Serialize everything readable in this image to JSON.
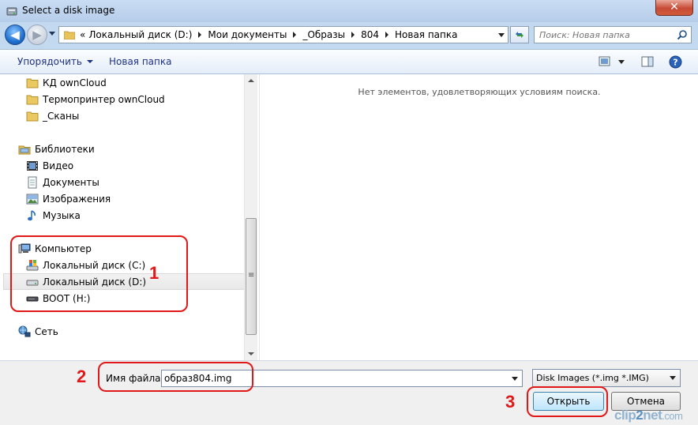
{
  "window": {
    "title": "Select a disk image",
    "close_label": "✕"
  },
  "address_bar": {
    "overflow": "«",
    "crumbs": [
      "Локальный диск (D:)",
      "Мои документы",
      "_Образы",
      "804",
      "Новая папка"
    ]
  },
  "search": {
    "placeholder": "Поиск: Новая папка"
  },
  "toolbar": {
    "organize_label": "Упорядочить",
    "new_folder_label": "Новая папка"
  },
  "tree": {
    "items": [
      {
        "label": "КД ownCloud",
        "icon": "folder-icon"
      },
      {
        "label": "Термопринтер ownCloud",
        "icon": "folder-icon"
      },
      {
        "label": "_Сканы",
        "icon": "folder-icon"
      },
      {
        "label": "Библиотеки",
        "icon": "libraries-icon"
      },
      {
        "label": "Видео",
        "icon": "video-icon"
      },
      {
        "label": "Документы",
        "icon": "documents-icon"
      },
      {
        "label": "Изображения",
        "icon": "pictures-icon"
      },
      {
        "label": "Музыка",
        "icon": "music-icon"
      },
      {
        "label": "Компьютер",
        "icon": "computer-icon"
      },
      {
        "label": "Локальный диск (C:)",
        "icon": "windows-drive-icon"
      },
      {
        "label": "Локальный диск (D:)",
        "icon": "drive-icon",
        "selected": true
      },
      {
        "label": "BOOT (H:)",
        "icon": "removable-drive-icon"
      },
      {
        "label": "Сеть",
        "icon": "network-icon"
      }
    ]
  },
  "content": {
    "empty_message": "Нет элементов, удовлетворяющих условиям поиска."
  },
  "footer": {
    "filename_label": "Имя файла:",
    "filename_value": "образ804.img",
    "filter_value": "Disk Images (*.img *.IMG)",
    "open_label": "Открыть",
    "cancel_label": "Отмена"
  },
  "annotations": {
    "one": "1",
    "two": "2",
    "three": "3",
    "color": "#e01818"
  },
  "watermark": {
    "part1": "clip",
    "part2": "2",
    "part3": "net",
    "part4": ".com"
  }
}
